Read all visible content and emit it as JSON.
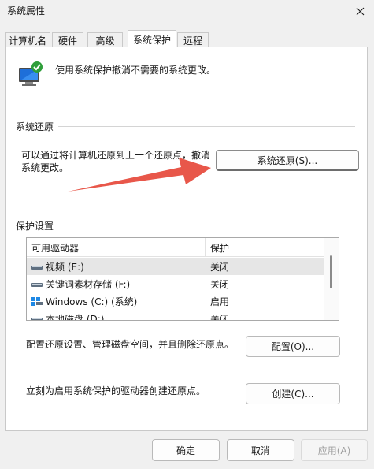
{
  "window": {
    "title": "系统属性"
  },
  "tabs": [
    {
      "label": "计算机名"
    },
    {
      "label": "硬件"
    },
    {
      "label": "高级"
    },
    {
      "label": "系统保护"
    },
    {
      "label": "远程"
    }
  ],
  "intro": {
    "text": "使用系统保护撤消不需要的系统更改。"
  },
  "restore_group": {
    "title": "系统还原",
    "desc_line1": "可以通过将计算机还原到上一个还原点，撤消",
    "desc_line2": "系统更改。",
    "button_label": "系统还原(S)..."
  },
  "protection_group": {
    "title": "保护设置",
    "columns": [
      "可用驱动器",
      "保护"
    ],
    "drives": [
      {
        "name": "视频 (E:)",
        "protection": "关闭",
        "icon": "drive-icon"
      },
      {
        "name": "关键词素材存储 (F:)",
        "protection": "关闭",
        "icon": "drive-icon"
      },
      {
        "name": "Windows (C:) (系统)",
        "protection": "启用",
        "icon": "windows-drive-icon"
      },
      {
        "name": "本地磁盘 (D:)",
        "protection": "关闭",
        "icon": "drive-icon"
      }
    ],
    "configure_text": "配置还原设置、管理磁盘空间，并且删除还原点。",
    "configure_button": "配置(O)...",
    "create_text": "立刻为启用系统保护的驱动器创建还原点。",
    "create_button": "创建(C)..."
  },
  "footer": {
    "ok": "确定",
    "cancel": "取消",
    "apply": "应用(A)"
  },
  "colors": {
    "arrow": "#e8574a",
    "window_bg": "#f0f0f0",
    "panel_bg": "#ffffff"
  }
}
